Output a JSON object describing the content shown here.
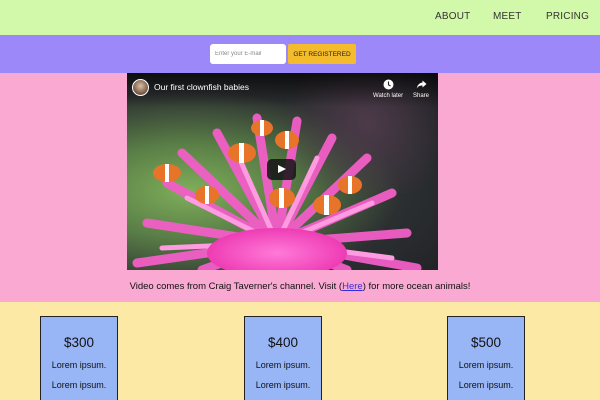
{
  "nav": {
    "items": [
      "ABOUT",
      "MEET",
      "PRICING"
    ]
  },
  "signup": {
    "email_placeholder": "Enter your E-mail",
    "button_label": "GET REGISTERED"
  },
  "video": {
    "title": "Our first clownfish babies",
    "actions": [
      {
        "label": "Watch later",
        "icon": "clock-icon"
      },
      {
        "label": "Share",
        "icon": "share-icon"
      }
    ],
    "play_icon": "play-icon"
  },
  "caption": {
    "prefix": "Video comes from Craig Taverner's channel. Visit (",
    "link": "Here",
    "suffix": ") for more ocean animals!"
  },
  "pricing": [
    {
      "price": "$300",
      "features": [
        "Lorem ipsum.",
        "Lorem ipsum."
      ]
    },
    {
      "price": "$400",
      "features": [
        "Lorem ipsum.",
        "Lorem ipsum."
      ]
    },
    {
      "price": "$500",
      "features": [
        "Lorem ipsum.",
        "Lorem ipsum."
      ]
    }
  ],
  "colors": {
    "nav_bg": "#d2f8aa",
    "signup_bg": "#9c88f8",
    "video_section_bg": "#f9a9d2",
    "pricing_bg": "#fde9a6",
    "card_bg": "#98b5f5",
    "button_bg": "#f4bc2c",
    "link": "#3a2bd6"
  }
}
